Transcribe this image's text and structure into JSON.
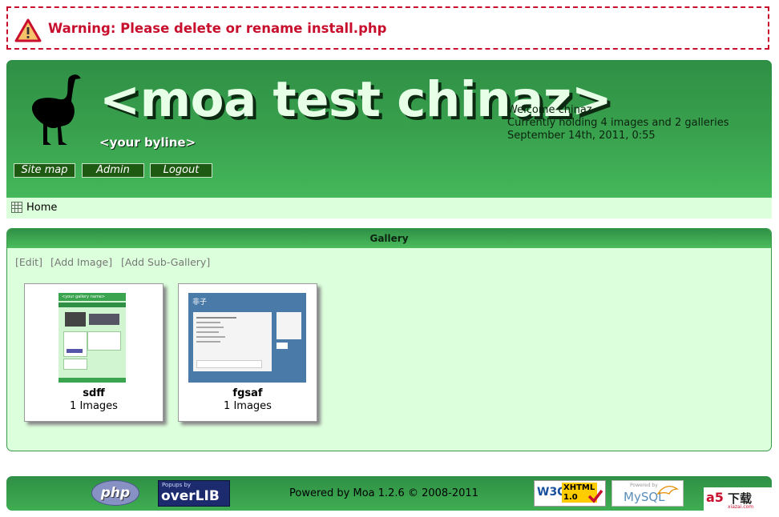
{
  "warning": {
    "text": "Warning: Please delete or rename install.php"
  },
  "header": {
    "title": "<moa test chinaz>",
    "byline": "<your byline>",
    "welcome": "Welcome chinaz",
    "holding": "Currently holding 4 images and 2 galleries",
    "datetime": "September 14th, 2011, 0:55",
    "nav": [
      "Site map",
      "Admin",
      "Logout"
    ]
  },
  "breadcrumb": {
    "home": "Home"
  },
  "gallery": {
    "title": "Gallery",
    "actions": [
      "[Edit]",
      "[Add Image]",
      "[Add Sub-Gallery]"
    ],
    "items": [
      {
        "name": "sdff",
        "count": "1 Images",
        "thumb_text": "<your gallery name>"
      },
      {
        "name": "fgsaf",
        "count": "1 Images",
        "thumb_text": "非子"
      }
    ]
  },
  "footer": {
    "powered": "Powered by Moa 1.2.6 © 2008-2011",
    "badges": {
      "php": "php",
      "overlib_small": "Popups by",
      "overlib": "overLIB",
      "w3c": "W3C",
      "xhtml": "XHTML",
      "xhtml_ver": "1.0",
      "mysql_small": "Powered by",
      "mysql": "MySQL",
      "a5": "a5",
      "a5_cn": "下载",
      "a5_url": "xiazai.com"
    }
  },
  "colors": {
    "warning": "#c8102e",
    "header_green": "#3aa44f",
    "light_green": "#dcffdc"
  }
}
